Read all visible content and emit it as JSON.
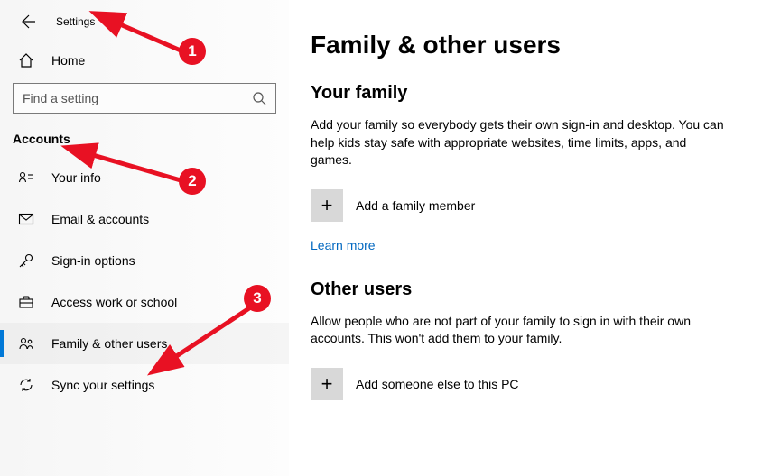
{
  "header": {
    "app_title": "Settings"
  },
  "search": {
    "placeholder": "Find a setting"
  },
  "home_label": "Home",
  "section_title": "Accounts",
  "nav_items": [
    {
      "label": "Your info"
    },
    {
      "label": "Email & accounts"
    },
    {
      "label": "Sign-in options"
    },
    {
      "label": "Access work or school"
    },
    {
      "label": "Family & other users"
    },
    {
      "label": "Sync your settings"
    }
  ],
  "page": {
    "title": "Family & other users",
    "family": {
      "heading": "Your family",
      "body": "Add your family so everybody gets their own sign-in and desktop. You can help kids stay safe with appropriate websites, time limits, apps, and games.",
      "add_label": "Add a family member",
      "learn_more": "Learn more"
    },
    "other": {
      "heading": "Other users",
      "body": "Allow people who are not part of your family to sign in with their own accounts. This won't add them to your family.",
      "add_label": "Add someone else to this PC"
    }
  },
  "annotations": {
    "m1": "1",
    "m2": "2",
    "m3": "3"
  }
}
